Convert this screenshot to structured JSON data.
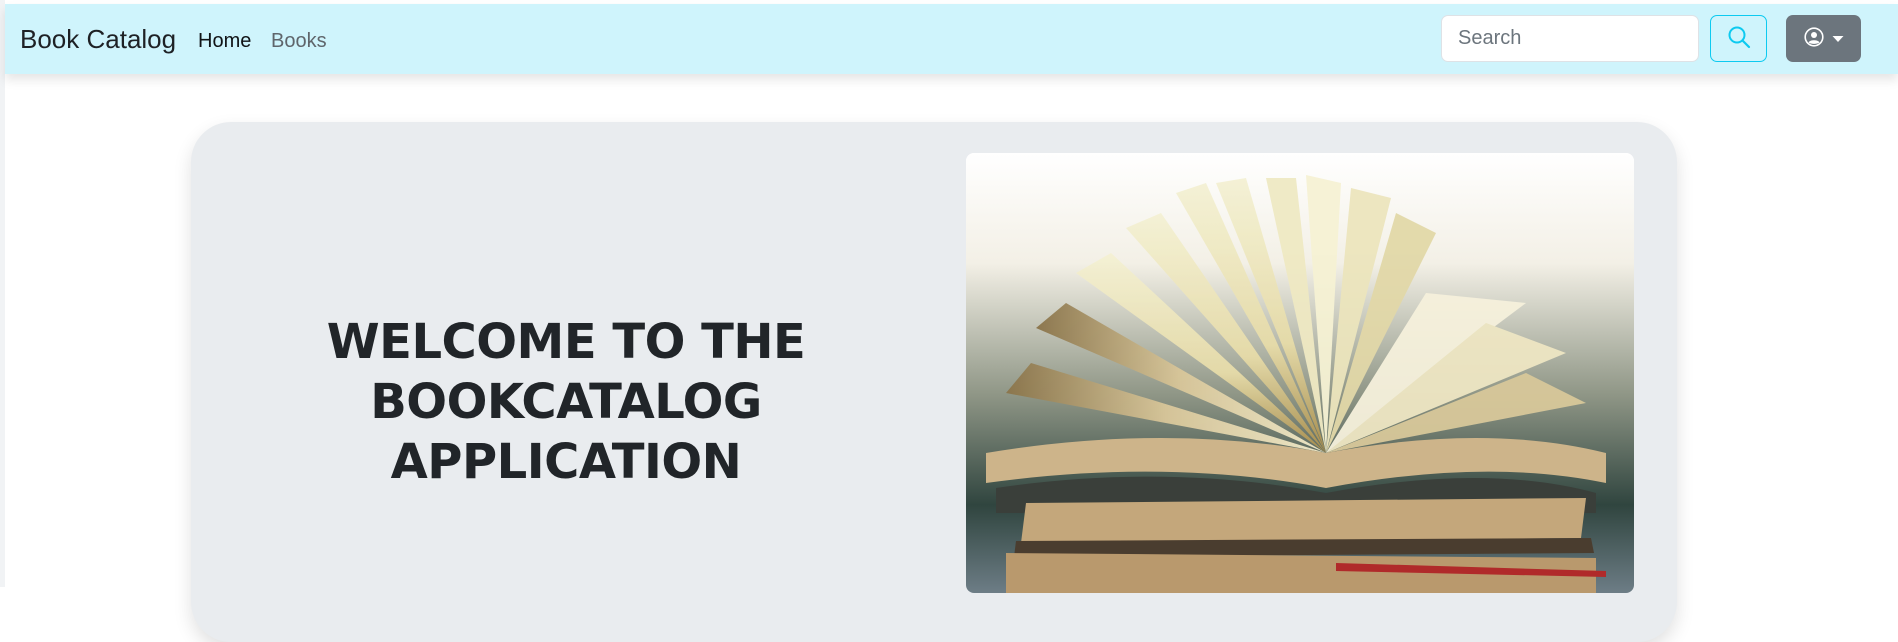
{
  "navbar": {
    "brand": "Book Catalog",
    "links": [
      {
        "label": "Home",
        "active": true
      },
      {
        "label": "Books",
        "active": false
      }
    ],
    "search": {
      "placeholder": "Search",
      "value": ""
    },
    "search_button_icon": "search-icon",
    "user_menu_icon": "user-circle-icon",
    "bg_color": "#cff4fc",
    "accent": "#0dcaf0"
  },
  "hero": {
    "title_line1": "WELCOME TO THE",
    "title_line2": "BOOKCATALOG APPLICATION",
    "image_subject": "stack-of-open-books",
    "bg_color": "#e9ecef"
  }
}
